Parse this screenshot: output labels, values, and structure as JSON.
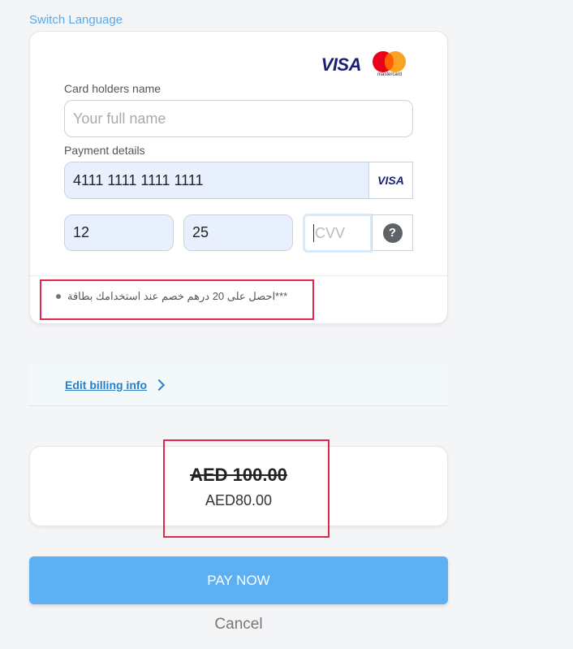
{
  "header": {
    "switch_language": "Switch Language"
  },
  "card_form": {
    "brands": {
      "visa": "VISA",
      "mastercard": "mastercard"
    },
    "name_label": "Card holders name",
    "name_placeholder": "Your full name",
    "payment_label": "Payment details",
    "card_number": "4111 1111 1111 1111",
    "card_badge": "VISA",
    "expiry_month": "12",
    "expiry_year": "25",
    "cvv_placeholder": "CVV",
    "help_icon": "?",
    "promo_text": "***احصل على 20 درهم خصم عند استخدامك بطاقة"
  },
  "billing": {
    "link": "Edit billing info"
  },
  "price": {
    "original": "AED 100.00",
    "discounted": "AED80.00"
  },
  "actions": {
    "pay_now": "PAY NOW",
    "cancel": "Cancel"
  },
  "colors": {
    "accent": "#5eb0f4",
    "highlight_border": "#e5264a",
    "link": "#2a7ec6"
  }
}
